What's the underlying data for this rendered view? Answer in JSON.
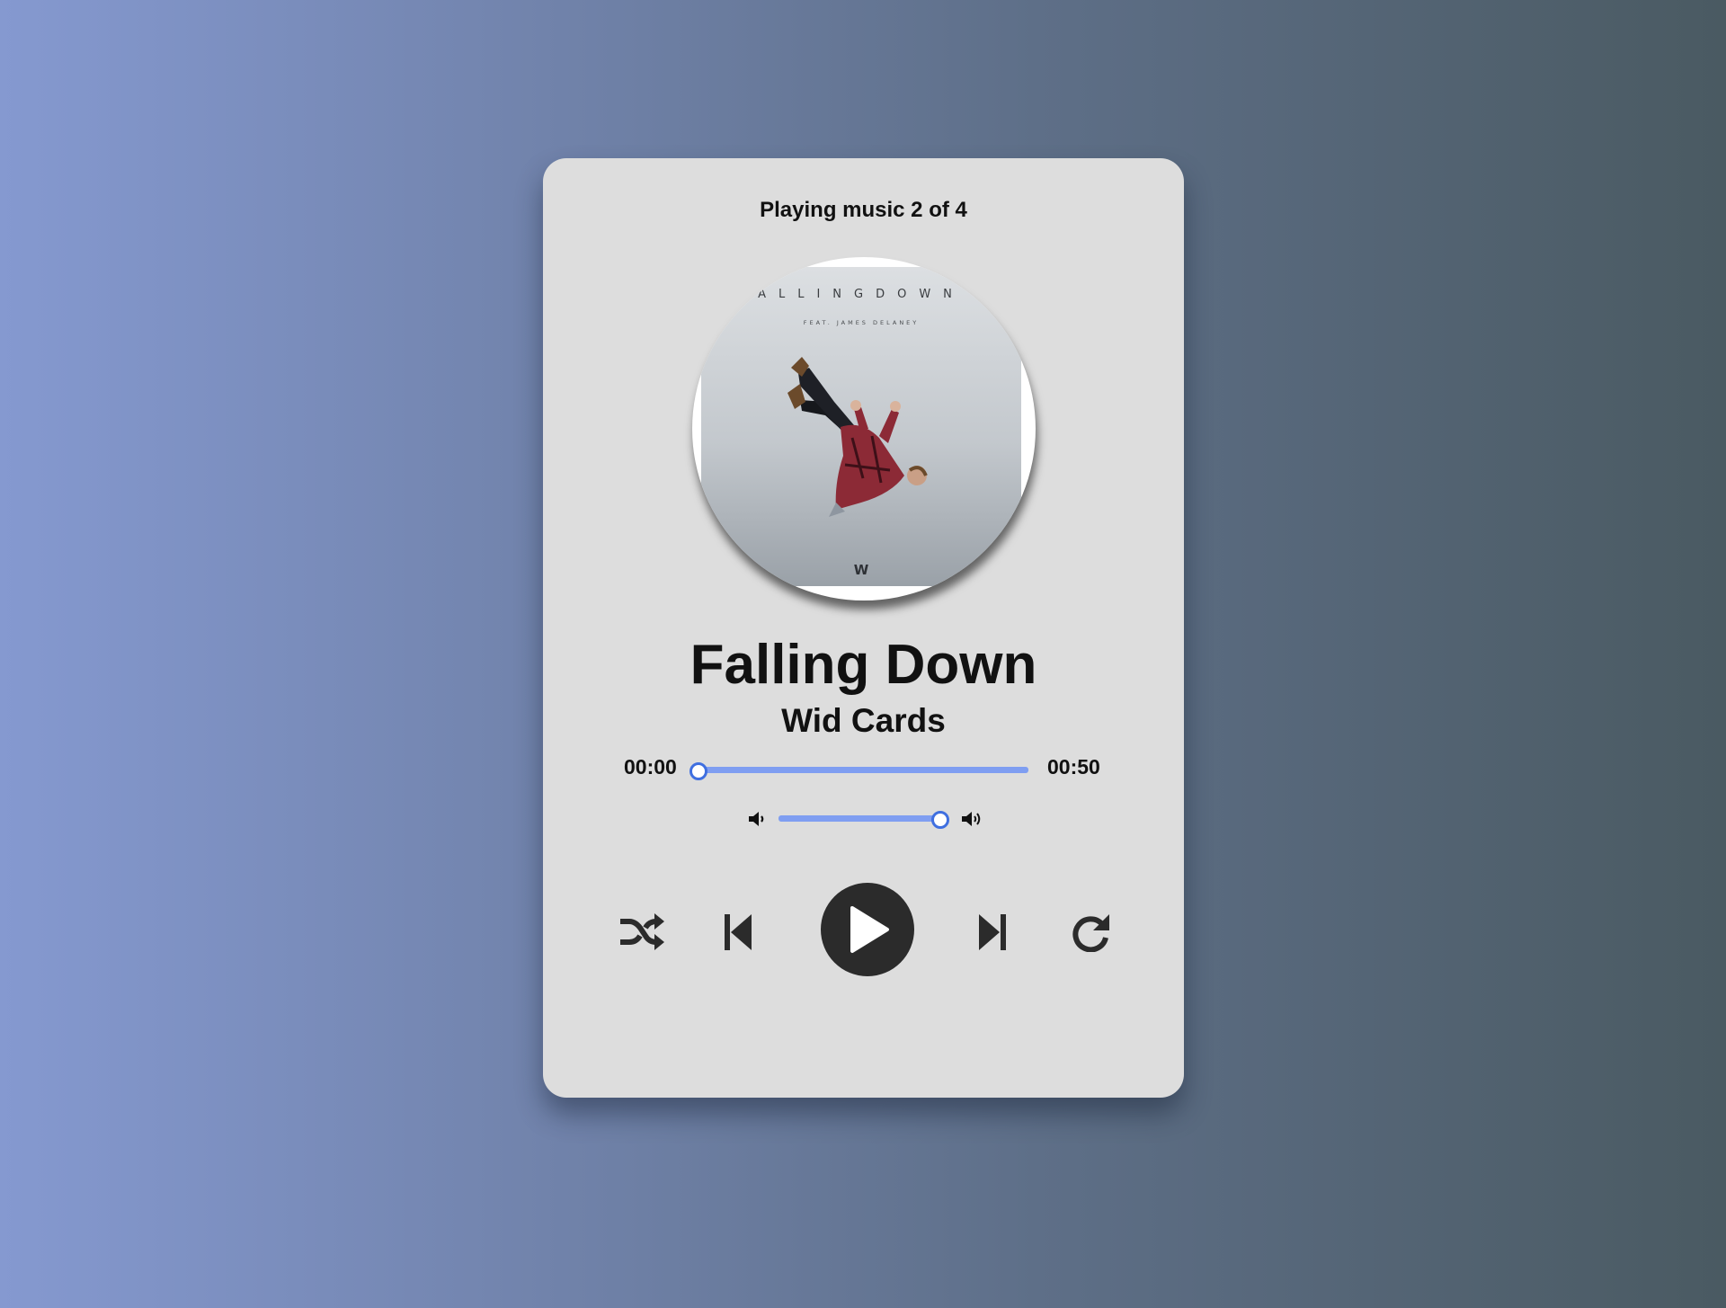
{
  "header": {
    "now_playing": "Playing music 2 of 4"
  },
  "album_art": {
    "cover_title_text": "ALLINGDOWN",
    "cover_feat_text": "FEAT. JAMES DELANEY",
    "cover_logo_text": "W"
  },
  "track": {
    "title": "Falling Down",
    "artist": "Wid Cards",
    "current_time": "00:00",
    "total_time": "00:50",
    "progress_fraction": 0.0
  },
  "volume": {
    "level_fraction": 0.95,
    "low_icon": "volume-down-icon",
    "high_icon": "volume-up-icon"
  },
  "controls": {
    "shuffle_icon": "shuffle-icon",
    "prev_icon": "skip-back-icon",
    "play_icon": "play-icon",
    "next_icon": "skip-forward-icon",
    "repeat_icon": "repeat-icon"
  },
  "colors": {
    "accent": "#3f6fe0",
    "track": "#7f9ef1",
    "card_bg": "#dddddd",
    "play_button": "#2b2b2b"
  }
}
